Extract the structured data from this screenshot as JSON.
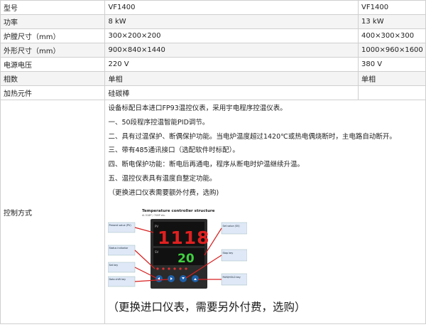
{
  "rows": [
    {
      "label": "型号",
      "c1": "VF1400",
      "c2": "VF1400"
    },
    {
      "label": "功率",
      "c1": "8 kW",
      "c2": "13 kW"
    },
    {
      "label": "炉膛尺寸（mm）",
      "c1": "300×200×200",
      "c2": "400×300×300"
    },
    {
      "label": "外形尺寸（mm）",
      "c1": "900×840×1440",
      "c2": "1000×960×1600"
    },
    {
      "label": "电源电压",
      "c1": "220 V",
      "c2": "380 V"
    },
    {
      "label": "相数",
      "c1": "单相",
      "c2": "单相"
    },
    {
      "label": "加热元件",
      "c1": "硅碳棒",
      "c2": ""
    }
  ],
  "control": {
    "label": "控制方式",
    "intro": "设备标配日本进口FP93温控仪表，采用宇电程序控温仪表。",
    "features": [
      "一、50段程序控温智能PID调节。",
      "二、具有过温保护、断偶保护功能。当电炉温度超过1420℃或热电偶烧断时，主电路自动断开。",
      "三、带有485通讯接口（选配软件时标配）。",
      "四、断电保护功能：断电后再通电，程序从断电时炉温继续升温。",
      "五、温控仪表具有温度自整定功能。",
      "（更换进口仪表需要额外付费，选购)"
    ],
    "panel": {
      "title": "Temperature controller structure",
      "subtitle": "AI-518P / 708P etc.",
      "pv_digits": "1118",
      "sv_digits": "20",
      "pv_label": "PV",
      "sv_label": "SV",
      "callouts_left": [
        "Present value (PV)",
        "Status indicator",
        "Set key",
        "Data shift key"
      ],
      "callouts_right": [
        "Set value (SV)",
        "Stop key",
        "RUN/HOLD key"
      ]
    },
    "caption": "（更换进口仪表，需要另外付费，选购）"
  },
  "colors": {
    "border": "#cfcfcf",
    "row_alt": "#f4f4f4",
    "pv_digit": "#e02020",
    "sv_digit": "#40d040",
    "callout_box": "#dfe8f6",
    "arrow": "#d82020"
  }
}
